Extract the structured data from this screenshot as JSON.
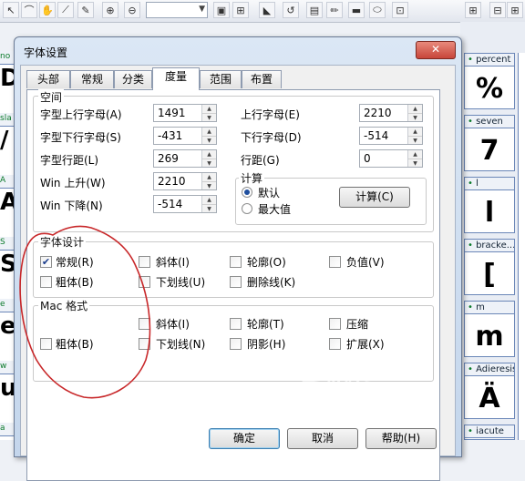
{
  "dialog": {
    "title": "字体设置",
    "close": "✕",
    "tabs": [
      "头部",
      "常规",
      "分类",
      "度量",
      "范围",
      "布置"
    ],
    "active_tab": "度量",
    "space_group": {
      "label": "空间",
      "left_fields": [
        {
          "label": "字型上行字母(A)",
          "value": "1491"
        },
        {
          "label": "字型下行字母(S)",
          "value": "-431"
        },
        {
          "label": "字型行距(L)",
          "value": "269"
        },
        {
          "label": "Win 上升(W)",
          "value": "2210"
        },
        {
          "label": "Win 下降(N)",
          "value": "-514"
        }
      ],
      "right_fields": [
        {
          "label": "上行字母(E)",
          "value": "2210"
        },
        {
          "label": "下行字母(D)",
          "value": "-514"
        },
        {
          "label": "行距(G)",
          "value": "0"
        }
      ],
      "calc": {
        "label": "计算",
        "options": [
          "默认",
          "最大值"
        ],
        "selected": "默认",
        "button": "计算(C)"
      }
    },
    "design_group": {
      "label": "字体设计",
      "checkboxes": [
        {
          "label": "常规(R)",
          "checked": true
        },
        {
          "label": "斜体(I)",
          "checked": false
        },
        {
          "label": "轮廓(O)",
          "checked": false
        },
        {
          "label": "负值(V)",
          "checked": false
        },
        {
          "label": "粗体(B)",
          "checked": false
        },
        {
          "label": "下划线(U)",
          "checked": false
        },
        {
          "label": "删除线(K)",
          "checked": false
        }
      ]
    },
    "mac_group": {
      "label": "Mac 格式",
      "checkboxes": [
        {
          "label": "斜体(I)",
          "checked": false
        },
        {
          "label": "轮廓(T)",
          "checked": false
        },
        {
          "label": "压缩",
          "checked": false
        },
        {
          "label": "粗体(B)",
          "checked": false
        },
        {
          "label": "下划线(N)",
          "checked": false
        },
        {
          "label": "阴影(H)",
          "checked": false
        },
        {
          "label": "扩展(X)",
          "checked": false
        }
      ]
    },
    "buttons": [
      "确定",
      "取消",
      "帮助(H)"
    ]
  },
  "glyph_cells": [
    {
      "name": "percent",
      "glyph": "%"
    },
    {
      "name": "seven",
      "glyph": "7"
    },
    {
      "name": "l",
      "glyph": "l"
    },
    {
      "name": "bracke...",
      "glyph": "["
    },
    {
      "name": "m",
      "glyph": "m"
    },
    {
      "name": "Adieresis",
      "glyph": "Ä"
    },
    {
      "name": "iacute",
      "glyph": ""
    }
  ],
  "left_cells": [
    {
      "name": "no",
      "glyph": "D"
    },
    {
      "name": "sla",
      "glyph": "/"
    },
    {
      "name": "A",
      "glyph": "A"
    },
    {
      "name": "S",
      "glyph": "S"
    },
    {
      "name": "e",
      "glyph": "e"
    },
    {
      "name": "w",
      "glyph": "u"
    },
    {
      "name": "a",
      "glyph": ""
    }
  ],
  "watermark": {
    "main": "手机论坛",
    "sub": "sjbbs.zol.com"
  },
  "colors": {
    "annotation": "#c8282a",
    "dialog_frame": "#c4d6ec",
    "cell_border": "#6b87b8"
  }
}
